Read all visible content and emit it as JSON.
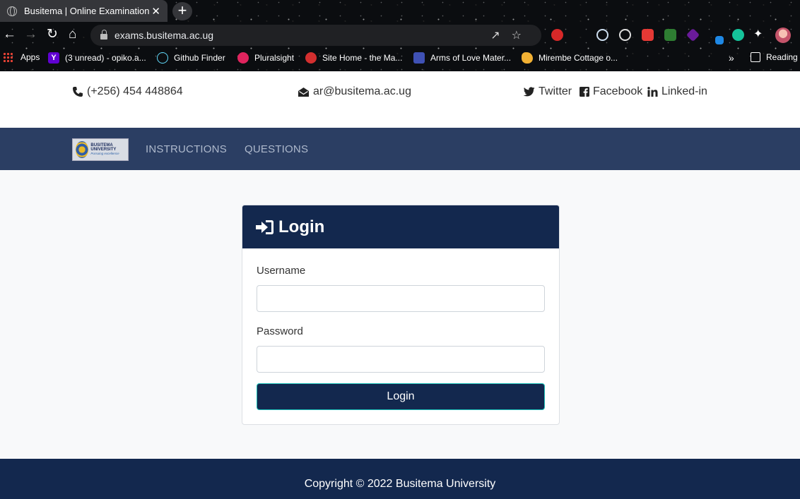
{
  "browser": {
    "tab_title": "Busitema | Online Examination",
    "tab_close": "✕",
    "new_tab": "+",
    "url": "exams.busitema.ac.ug",
    "bookmarks": [
      {
        "label": "Apps",
        "icon": "apps-grid-icon"
      },
      {
        "label": "(3 unread) - opiko.a...",
        "icon": "yahoo-icon",
        "color": "#6001d2"
      },
      {
        "label": "Github Finder",
        "icon": "react-icon",
        "color": "#61dafb"
      },
      {
        "label": "Pluralsight",
        "icon": "pluralsight-icon",
        "color": "#f15b2a"
      },
      {
        "label": "Site Home - the Ma...",
        "icon": "site-icon",
        "color": "#d32f2f"
      },
      {
        "label": "Arms of Love Mater...",
        "icon": "calendar-icon",
        "color": "#3f51b5"
      },
      {
        "label": "Mirembe Cottage o...",
        "icon": "africa-icon",
        "color": "#f2b134"
      }
    ],
    "more_bookmarks": "»",
    "reading_list": "Reading"
  },
  "contact": {
    "phone": "(+256) 454 448864",
    "email": "ar@busitema.ac.ug",
    "twitter": "Twitter",
    "facebook": "Facebook",
    "linkedin": "Linked-in"
  },
  "nav": {
    "logo_line1": "BUSITEMA UNIVERSITY",
    "logo_line2": "Pursuing excellence",
    "instructions": "INSTRUCTIONS",
    "questions": "QUESTIONS"
  },
  "login": {
    "title": "Login",
    "username_label": "Username",
    "username_value": "",
    "password_label": "Password",
    "password_value": "",
    "button": "Login"
  },
  "footer": {
    "copyright": "Copyright © 2022 Busitema University"
  },
  "colors": {
    "navbar": "#2b3e63",
    "primary": "#13284e",
    "button_border": "#1ac0b8"
  }
}
